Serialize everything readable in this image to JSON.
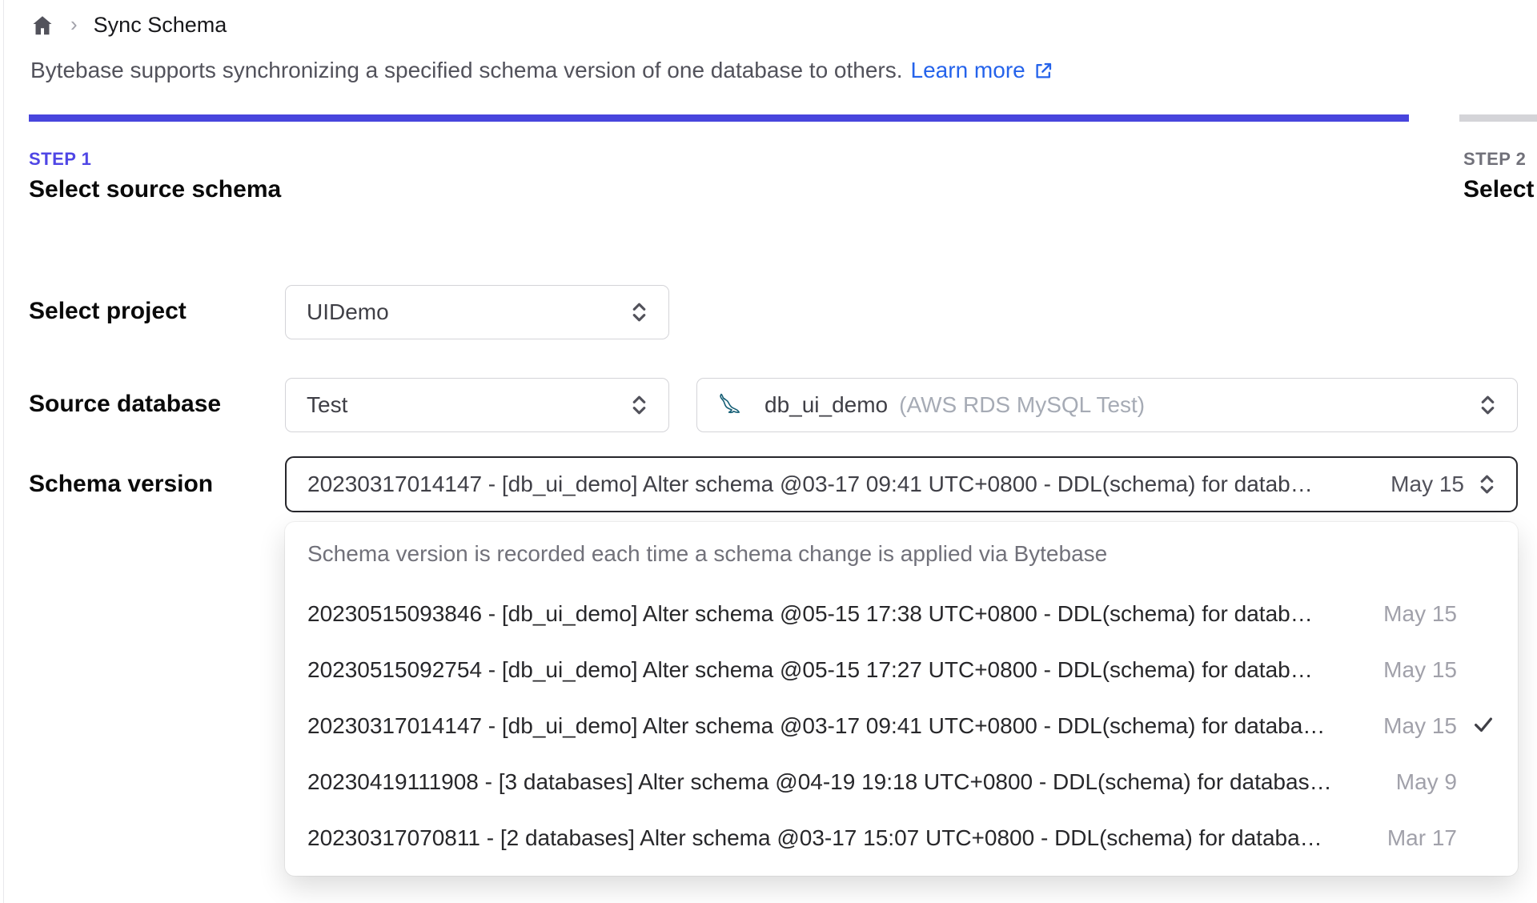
{
  "breadcrumb": {
    "title": "Sync Schema"
  },
  "intro": {
    "text": "Bytebase supports synchronizing a specified schema version of one database to others.",
    "link": "Learn more"
  },
  "steps": {
    "step1": {
      "label": "STEP 1",
      "title": "Select source schema"
    },
    "step2": {
      "label": "STEP 2",
      "title": "Select t"
    }
  },
  "form": {
    "project_label": "Select project",
    "project_value": "UIDemo",
    "source_db_label": "Source database",
    "environment_value": "Test",
    "database_name": "db_ui_demo",
    "database_detail": "(AWS RDS MySQL Test)",
    "schema_version_label": "Schema version",
    "schema_version_value": "20230317014147 - [db_ui_demo] Alter schema @03-17 09:41 UTC+0800 - DDL(schema) for datab…",
    "schema_version_date": "May 15"
  },
  "version_dropdown": {
    "hint": "Schema version is recorded each time a schema change is applied via Bytebase",
    "options": [
      {
        "text": "20230515093846 - [db_ui_demo] Alter schema @05-15 17:38 UTC+0800 - DDL(schema) for datab…",
        "date": "May 15",
        "selected": false
      },
      {
        "text": "20230515092754 - [db_ui_demo] Alter schema @05-15 17:27 UTC+0800 - DDL(schema) for datab…",
        "date": "May 15",
        "selected": false
      },
      {
        "text": "20230317014147 - [db_ui_demo] Alter schema @03-17 09:41 UTC+0800 - DDL(schema) for databa…",
        "date": "May 15",
        "selected": true
      },
      {
        "text": "20230419111908 - [3 databases] Alter schema @04-19 19:18 UTC+0800 - DDL(schema) for databas…",
        "date": "May 9",
        "selected": false
      },
      {
        "text": "20230317070811 - [2 databases] Alter schema @03-17 15:07 UTC+0800 - DDL(schema) for databa…",
        "date": "Mar 17",
        "selected": false
      }
    ]
  },
  "icons": {
    "home": "home-icon",
    "breadcrumb_separator": "chevron-right-icon",
    "external_link": "external-link-icon",
    "select_arrows": "updown-chevron-icon",
    "database_engine": "mysql-dolphin-icon",
    "selected_mark": "check-icon"
  },
  "colors": {
    "accent_indigo": "#4f46e5",
    "progress_blue": "#4845dd",
    "progress_gray": "#d4d4d8",
    "link_blue": "#2563eb",
    "focus_border": "#26262b",
    "muted_text": "#a1a1aa"
  }
}
